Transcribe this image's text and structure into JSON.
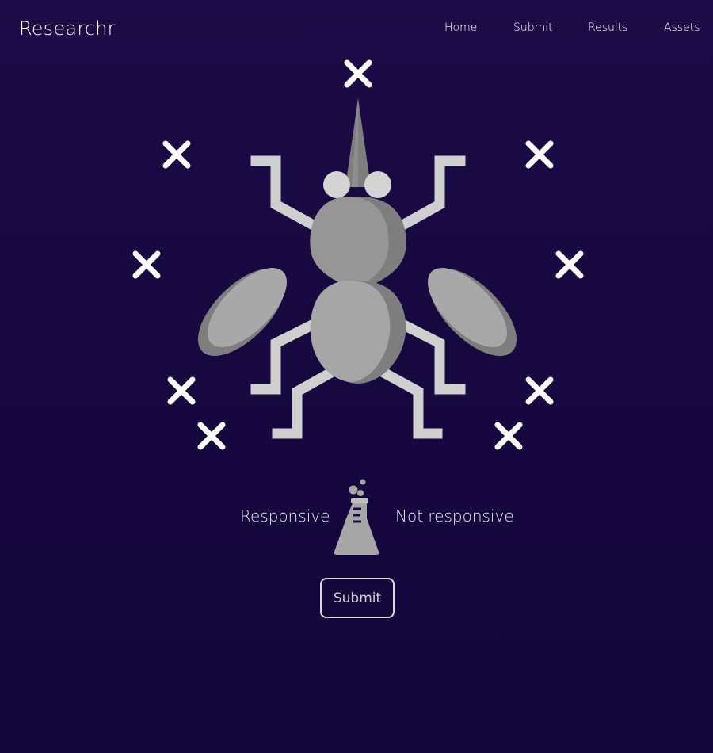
{
  "app": {
    "brand": "Researchr"
  },
  "nav": {
    "items": [
      {
        "label": "Home"
      },
      {
        "label": "Submit"
      },
      {
        "label": "Results"
      },
      {
        "label": "Assets"
      }
    ]
  },
  "insect": {
    "icon": "mosquito-icon"
  },
  "marks": {
    "icon": "close-icon",
    "color": "#ffffff"
  },
  "choices": {
    "responsive": "Responsive",
    "not_responsive": "Not responsive"
  },
  "flask": {
    "icon": "flask-icon"
  },
  "submit": {
    "label": "Submit",
    "disabled": true
  },
  "colors": {
    "background": "#1a0a44",
    "insect_light": "#a6a6a6",
    "insect_dark": "#7e7e7e",
    "legs": "#cfcfcf"
  }
}
